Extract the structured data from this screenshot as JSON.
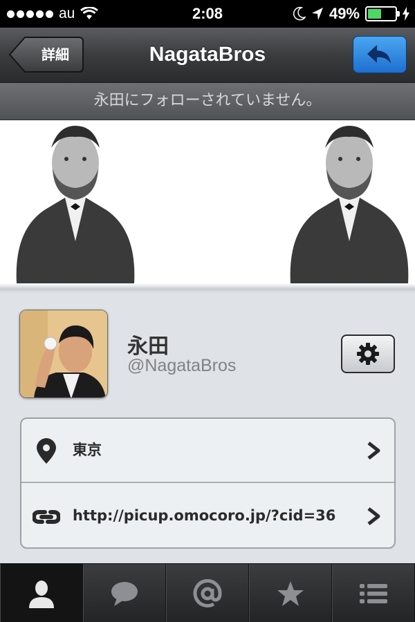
{
  "status_bar": {
    "carrier": "au",
    "time": "2:08",
    "battery_percent": "49%",
    "battery_level": 0.49,
    "icons": [
      "signal-dots-icon",
      "wifi-icon",
      "moon-icon",
      "location-arrow-icon",
      "battery-icon",
      "charging-bolt-icon"
    ]
  },
  "nav": {
    "back_label": "詳細",
    "title": "NagataBros",
    "reply_icon": "reply-icon"
  },
  "follow_status": "永田にフォローされていません。",
  "profile": {
    "display_name": "永田",
    "screen_name": "@NagataBros",
    "settings_icon": "gear-icon"
  },
  "info_rows": [
    {
      "icon": "map-pin-icon",
      "label": "東京"
    },
    {
      "icon": "link-icon",
      "label": "http://picup.omocoro.jp/?cid=36"
    }
  ],
  "tabs": [
    {
      "icon": "person-icon",
      "active": true
    },
    {
      "icon": "speech-bubble-icon",
      "active": false
    },
    {
      "icon": "at-sign-icon",
      "active": false
    },
    {
      "icon": "star-icon",
      "active": false
    },
    {
      "icon": "list-icon",
      "active": false
    }
  ],
  "colors": {
    "nav_dark": "#3a3c3e",
    "reply_blue": "#1e6fd1",
    "battery_green": "#4cd964",
    "list_background": "#ecf0f3"
  }
}
